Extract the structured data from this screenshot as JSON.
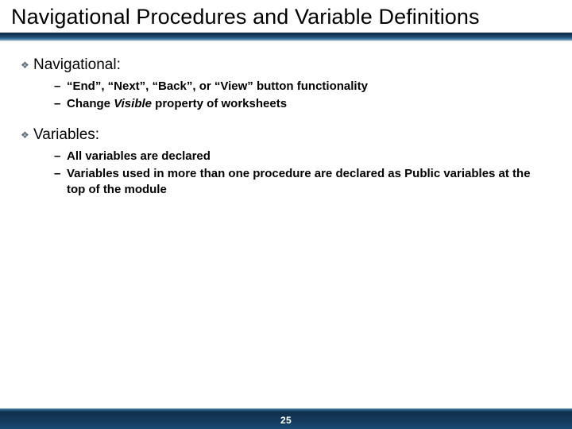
{
  "title": "Navigational Procedures and Variable Definitions",
  "sections": [
    {
      "heading": "Navigational:",
      "items": [
        {
          "text": "“End”, “Next”, “Back”, or “View” button functionality"
        },
        {
          "prefix": "Change ",
          "em": "Visible",
          "suffix": " property of worksheets"
        }
      ]
    },
    {
      "heading": "Variables:",
      "items": [
        {
          "text": "All variables are declared"
        },
        {
          "text": "Variables used in more than one procedure are declared as Public variables at the top of the module"
        }
      ]
    }
  ],
  "page_number": "25"
}
